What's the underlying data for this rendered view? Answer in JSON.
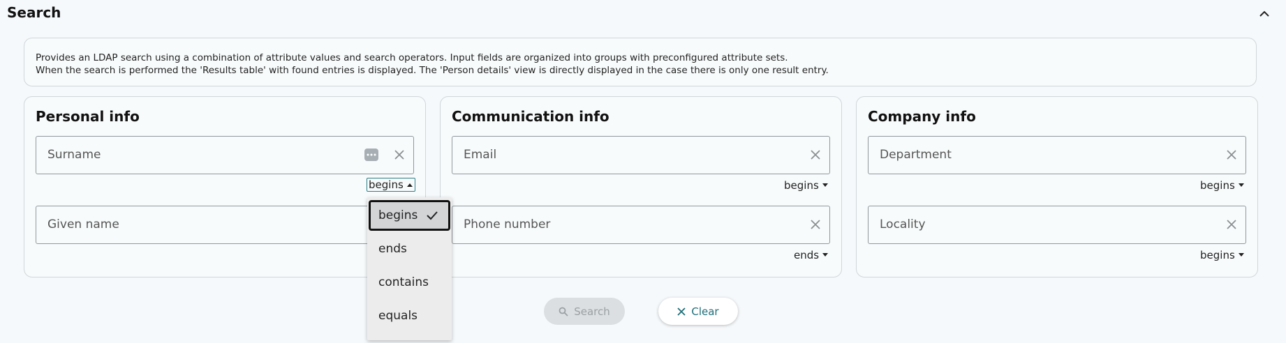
{
  "section": {
    "title": "Search",
    "collapse_icon": "chevron-up-icon"
  },
  "description": {
    "line1": "Provides an LDAP search using a combination of attribute values and search operators. Input fields are organized into groups with preconfigured attribute sets.",
    "line2": "When the search is performed the 'Results table' with found entries is displayed. The 'Person details' view is directly displayed in the case there is only one result entry."
  },
  "cards": {
    "personal": {
      "title": "Personal info",
      "fields": [
        {
          "label": "Surname",
          "operator": "begins"
        },
        {
          "label": "Given name"
        }
      ]
    },
    "communication": {
      "title": "Communication info",
      "fields": [
        {
          "label": "Email",
          "operator": "begins"
        },
        {
          "label": "Phone number",
          "operator": "ends"
        }
      ]
    },
    "company": {
      "title": "Company info",
      "fields": [
        {
          "label": "Department",
          "operator": "begins"
        },
        {
          "label": "Locality",
          "operator": "begins"
        }
      ]
    }
  },
  "operator_menu": {
    "options": [
      "begins",
      "ends",
      "contains",
      "equals"
    ],
    "selected": "begins"
  },
  "actions": {
    "search_label": "Search",
    "clear_label": "Clear"
  },
  "colors": {
    "accent": "#1e6d78",
    "background": "#f6f9fb",
    "border": "#cfd6da"
  }
}
